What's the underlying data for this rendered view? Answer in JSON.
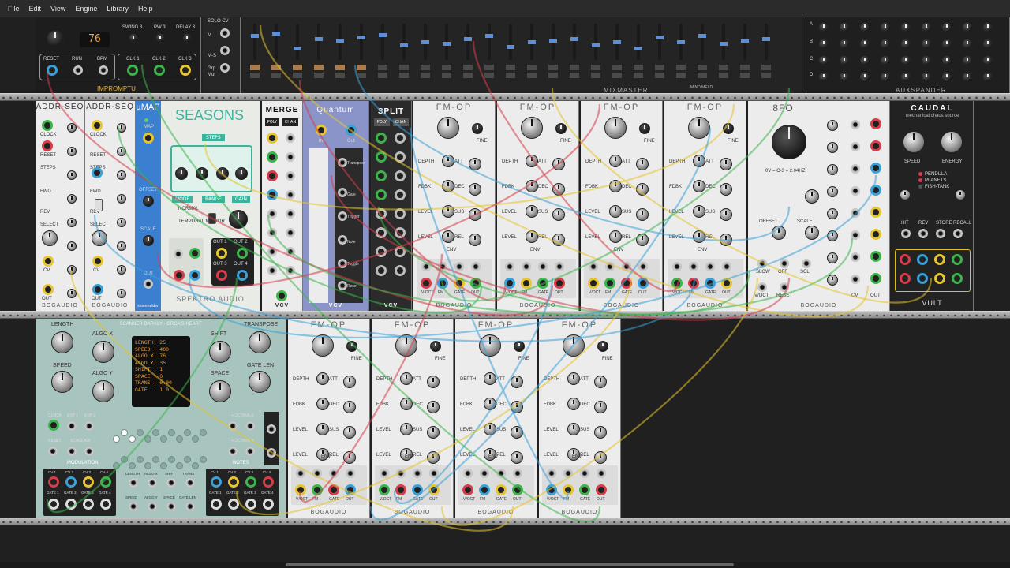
{
  "menu": [
    "File",
    "Edit",
    "View",
    "Engine",
    "Library",
    "Help"
  ],
  "top_row": {
    "clock": {
      "display": "76",
      "labels": [
        "SWING 3",
        "PW 3",
        "DELAY 3"
      ],
      "outs": [
        "RESET",
        "RUN",
        "BPM",
        "CLK 1",
        "CLK 2",
        "CLK 3"
      ],
      "footer": "IMPROMPTU"
    },
    "solo_strip": [
      "SOLO CV",
      "M",
      "M-S",
      "Grp",
      "Mut"
    ],
    "mixer": {
      "name": "MIXMASTER",
      "brand": "MIND MELD"
    },
    "aux": {
      "name": "AUXSPANDER",
      "letters": [
        "A",
        "B",
        "C",
        "D"
      ]
    }
  },
  "middle_row": {
    "addr_seq": {
      "name": "ADDR-SEQ",
      "labels": [
        "CLOCK",
        "RESET",
        "STEPS",
        "FWD",
        "REV",
        "SELECT",
        "CV",
        "OUT"
      ],
      "footer": "BOGAUDIO"
    },
    "umap": {
      "name": "µMAP",
      "labels": [
        "MAP",
        "OFFSET",
        "SCALE",
        "OUT"
      ],
      "footer": "stoermelder"
    },
    "seasons": {
      "name": "SEASONS",
      "tab": "STEPS",
      "buttons": [
        "MODE",
        "RANGE",
        "GAIN"
      ],
      "options": [
        "NORMAL",
        "TEMPORAL MIRROR"
      ],
      "outs": [
        "OUT 1",
        "OUT 2",
        "OUT 3",
        "OUT 4"
      ],
      "footer": "SPEKTRO AUDIO"
    },
    "merge": {
      "name": "MERGE",
      "labels": [
        "POLY",
        "CHAN"
      ],
      "footer": "VCV"
    },
    "quantum": {
      "name": "Quantum",
      "labels": [
        "In",
        "Out",
        "Transpose",
        "Gate",
        "Trigger",
        "Note",
        "Toggle",
        "Reset"
      ],
      "footer": "VCV"
    },
    "split": {
      "name": "SPLIT",
      "labels": [
        "POLY",
        "CHAN"
      ],
      "footer": "VCV"
    },
    "fm_op": {
      "name": "FM-OP",
      "labels": [
        "RATIO",
        "FINE",
        "DEPTH",
        "ATT",
        "DEC",
        "FDBK",
        "SUS",
        "LEVEL",
        "REL",
        "ENV",
        "V/OCT",
        "FM",
        "GATE",
        "OUT"
      ],
      "footer": "BOGAUDIO"
    },
    "eight_fo": {
      "name": "8FO",
      "freq": "0V = C-3 = 2.04HZ",
      "labels": [
        "OFFSET",
        "SCALE",
        "SLOW",
        "OFF",
        "SCL",
        "V/OCT",
        "RESET",
        "CV",
        "OUT"
      ],
      "footer": "BOGAUDIO"
    },
    "caudal": {
      "name": "CAUDAL",
      "subtitle": "mechanical chaos source",
      "knobs": [
        "SPEED",
        "ENERGY"
      ],
      "modes": [
        "PENDULA",
        "PLANETS",
        "FISH-TANK"
      ],
      "buttons": [
        "HIT",
        "REV",
        "STORE",
        "RECALL"
      ],
      "footer": "VULT"
    }
  },
  "bottom_row": {
    "orca": {
      "title": "SCANNER DARKLY - ORCA'S HEART",
      "knobs": [
        "LENGTH",
        "ALGO X",
        "SPEED",
        "ALGO Y",
        "SHIFT",
        "TRANSPOSE",
        "SPACE",
        "GATE LEN"
      ],
      "display": [
        "LENGTH: 25",
        "SPEED : 400",
        "ALGO X: 76",
        "ALGO Y: 35",
        "SHIFT : 1",
        "SPACE : 0",
        "TRANS : 0.00",
        "GATE L: 1.0"
      ],
      "jacks": [
        "CLOCK",
        "EXP 1",
        "EXP 2",
        "RESET",
        "SCALE A/B",
        "MODULATION",
        "NOTES",
        "+ OCTAVE A",
        "+ OCTAVE B"
      ],
      "outs": [
        "CV 1",
        "CV 2",
        "CV 3",
        "CV 4",
        "GATE 1",
        "GATE 2",
        "GATE 3",
        "GATE 4"
      ],
      "mod_labels": [
        "LENGTH",
        "ALGO X",
        "SHIFT",
        "TRANS",
        "SPEED",
        "ALGO Y",
        "SPACE",
        "GATE LEN"
      ]
    },
    "fm_op_footer": "BOGAUDIO"
  },
  "colors": {
    "rack": "#202020",
    "rail": "#a8a8a8",
    "fm_panel": "#ececec",
    "orca_panel": "#a7c4be",
    "umap": "#3b7fd0",
    "quantum": "#8a94c9",
    "caudal": "#222222"
  }
}
